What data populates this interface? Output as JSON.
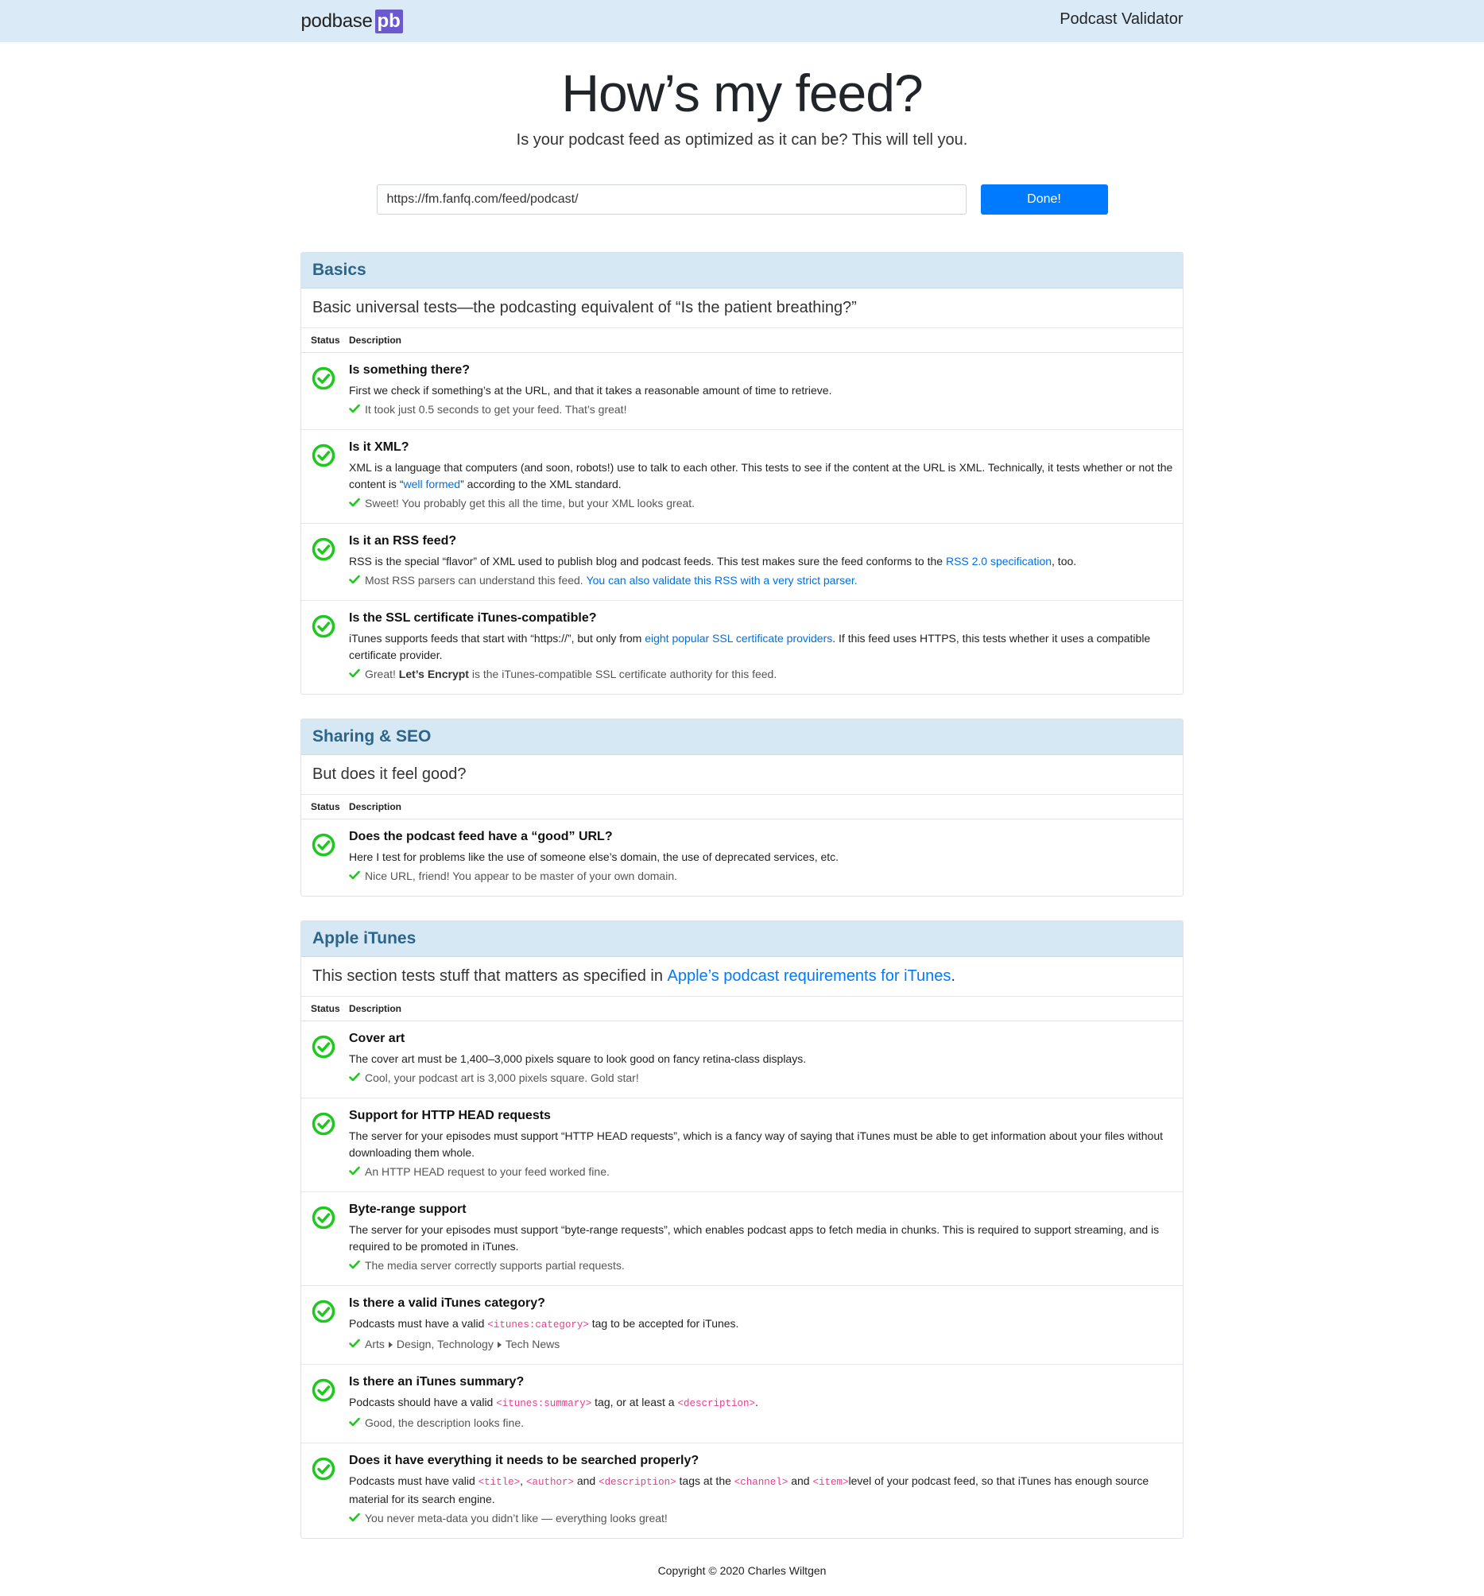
{
  "nav": {
    "brand": "podbase",
    "brand_badge": "pb",
    "title": "Podcast Validator"
  },
  "hero": {
    "title": "How’s my feed?",
    "subtitle": "Is your podcast feed as optimized as it can be? This will tell you."
  },
  "search": {
    "value": "https://fm.fanfq.com/feed/podcast/",
    "button": "Done!"
  },
  "table_headers": {
    "status": "Status",
    "description": "Description"
  },
  "basics": {
    "title": "Basics",
    "lead": "Basic universal tests—the podcasting equivalent of “Is the patient breathing?”",
    "rows": [
      {
        "title": "Is something there?",
        "desc": "First we check if something’s at the URL, and that it takes a reasonable amount of time to retrieve.",
        "result": "It took just 0.5 seconds to get your feed. That’s great!"
      },
      {
        "title": "Is it XML?",
        "desc_a": "XML is a language that computers (and soon, robots!) use to talk to each other. This tests to see if the content at the URL is XML. Technically, it tests whether or not the content is “",
        "desc_link": "well formed",
        "desc_b": "” according to the XML standard.",
        "result": "Sweet! You probably get this all the time, but your XML looks great."
      },
      {
        "title": "Is it an RSS feed?",
        "desc_a": "RSS is the special “flavor” of XML used to publish blog and podcast feeds. This test makes sure the feed conforms to the ",
        "desc_link": "RSS 2.0 specification",
        "desc_b": ", too.",
        "result_a": "Most RSS parsers can understand this feed. ",
        "result_link": "You can also validate this RSS with a very strict parser."
      },
      {
        "title": "Is the SSL certificate iTunes-compatible?",
        "desc_a": "iTunes supports feeds that start with “https://”, but only from ",
        "desc_link": "eight popular SSL certificate providers",
        "desc_b": ". If this feed uses HTTPS, this tests whether it uses a compatible certificate provider.",
        "result_a": "Great! ",
        "result_bold": "Let’s Encrypt",
        "result_b": " is the iTunes-compatible SSL certificate authority for this feed."
      }
    ]
  },
  "sharing": {
    "title": "Sharing & SEO",
    "lead": "But does it feel good?",
    "rows": [
      {
        "title": "Does the podcast feed have a “good” URL?",
        "desc": "Here I test for problems like the use of someone else’s domain, the use of deprecated services, etc.",
        "result": "Nice URL, friend! You appear to be master of your own domain."
      }
    ]
  },
  "itunes": {
    "title": "Apple iTunes",
    "lead_a": "This section tests stuff that matters as specified in ",
    "lead_link": "Apple’s podcast requirements for iTunes",
    "lead_b": ".",
    "rows": [
      {
        "title": "Cover art",
        "desc": "The cover art must be 1,400–3,000 pixels square to look good on fancy retina-class displays.",
        "result": "Cool, your podcast art is 3,000 pixels square. Gold star!"
      },
      {
        "title": "Support for HTTP HEAD requests",
        "desc": "The server for your episodes must support “HTTP HEAD requests”, which is a fancy way of saying that iTunes must be able to get information about your files without downloading them whole.",
        "result": "An HTTP HEAD request to your feed worked fine."
      },
      {
        "title": "Byte-range support",
        "desc": "The server for your episodes must support “byte-range requests”, which enables podcast apps to fetch media in chunks. This is required to support streaming, and is required to be promoted in iTunes.",
        "result": "The media server correctly supports partial requests."
      },
      {
        "title": "Is there a valid iTunes category?",
        "desc_a": "Podcasts must have a valid ",
        "desc_code": "<itunes:category>",
        "desc_b": " tag to be accepted for iTunes.",
        "crumbs": [
          "Arts",
          "Design, Technology",
          "Tech News"
        ]
      },
      {
        "title": "Is there an iTunes summary?",
        "desc_a": "Podcasts should have a valid ",
        "desc_code1": "<itunes:summary>",
        "desc_b": " tag, or at least a ",
        "desc_code2": "<description>",
        "desc_c": ".",
        "result": "Good, the description looks fine."
      },
      {
        "title": "Does it have everything it needs to be searched properly?",
        "desc_a": "Podcasts must have valid ",
        "code_title": "<title>",
        "sep1": ", ",
        "code_author": "<author>",
        "sep2": " and ",
        "code_description": "<description>",
        "desc_b": " tags at the ",
        "code_channel": "<channel>",
        "sep3": " and ",
        "code_item": "<item>",
        "desc_c": "level of your podcast feed, so that iTunes has enough source material for its search engine.",
        "result": "You never meta-data you didn’t like — everything looks great!"
      }
    ]
  },
  "footer": "Copyright © 2020 Charles Wiltgen",
  "colors": {
    "accent": "#007bff",
    "section_header": "#d6e8f4",
    "pass": "#1ec81e"
  },
  "icons": {
    "status": "check-circle-icon",
    "result": "check-icon"
  }
}
